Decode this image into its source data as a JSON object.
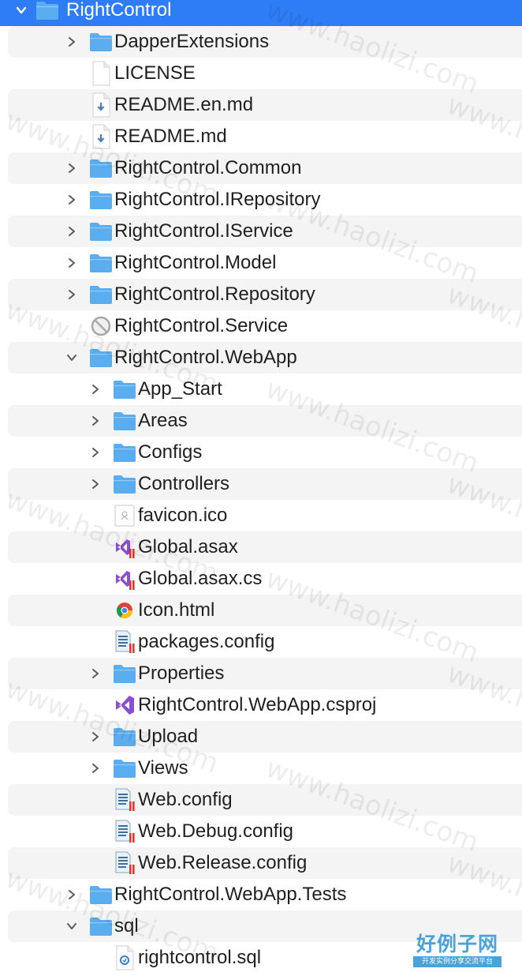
{
  "tree": {
    "items": [
      {
        "label": "RightControl",
        "depth": 0,
        "type": "folder",
        "chevron": "down",
        "selected": true
      },
      {
        "label": "DapperExtensions",
        "depth": 1,
        "type": "folder",
        "chevron": "right"
      },
      {
        "label": "LICENSE",
        "depth": 1,
        "type": "blank-file"
      },
      {
        "label": "README.en.md",
        "depth": 1,
        "type": "markdown-file"
      },
      {
        "label": "README.md",
        "depth": 1,
        "type": "markdown-file"
      },
      {
        "label": "RightControl.Common",
        "depth": 1,
        "type": "folder",
        "chevron": "right"
      },
      {
        "label": "RightControl.IRepository",
        "depth": 1,
        "type": "folder",
        "chevron": "right"
      },
      {
        "label": "RightControl.IService",
        "depth": 1,
        "type": "folder",
        "chevron": "right"
      },
      {
        "label": "RightControl.Model",
        "depth": 1,
        "type": "folder",
        "chevron": "right"
      },
      {
        "label": "RightControl.Repository",
        "depth": 1,
        "type": "folder",
        "chevron": "right"
      },
      {
        "label": "RightControl.Service",
        "depth": 1,
        "type": "unavailable"
      },
      {
        "label": "RightControl.WebApp",
        "depth": 1,
        "type": "folder",
        "chevron": "down"
      },
      {
        "label": "App_Start",
        "depth": 2,
        "type": "folder",
        "chevron": "right"
      },
      {
        "label": "Areas",
        "depth": 2,
        "type": "folder",
        "chevron": "right"
      },
      {
        "label": "Configs",
        "depth": 2,
        "type": "folder",
        "chevron": "right"
      },
      {
        "label": "Controllers",
        "depth": 2,
        "type": "folder",
        "chevron": "right"
      },
      {
        "label": "favicon.ico",
        "depth": 2,
        "type": "image-file"
      },
      {
        "label": "Global.asax",
        "depth": 2,
        "type": "vs-file"
      },
      {
        "label": "Global.asax.cs",
        "depth": 2,
        "type": "vs-file"
      },
      {
        "label": "Icon.html",
        "depth": 2,
        "type": "chrome-file"
      },
      {
        "label": "packages.config",
        "depth": 2,
        "type": "config-file"
      },
      {
        "label": "Properties",
        "depth": 2,
        "type": "folder",
        "chevron": "right"
      },
      {
        "label": "RightControl.WebApp.csproj",
        "depth": 2,
        "type": "vs-project"
      },
      {
        "label": "Upload",
        "depth": 2,
        "type": "folder",
        "chevron": "right"
      },
      {
        "label": "Views",
        "depth": 2,
        "type": "folder",
        "chevron": "right"
      },
      {
        "label": "Web.config",
        "depth": 2,
        "type": "config-file"
      },
      {
        "label": "Web.Debug.config",
        "depth": 2,
        "type": "config-file"
      },
      {
        "label": "Web.Release.config",
        "depth": 2,
        "type": "config-file"
      },
      {
        "label": "RightControl.WebApp.Tests",
        "depth": 1,
        "type": "folder",
        "chevron": "right"
      },
      {
        "label": "sql",
        "depth": 1,
        "type": "folder",
        "chevron": "down"
      },
      {
        "label": "rightcontrol.sql",
        "depth": 2,
        "type": "sql-file"
      }
    ]
  },
  "watermark": {
    "text": "www.haolizi.com"
  },
  "brand": {
    "title": "好例子网",
    "subtitle": "开发实例分享交流平台"
  },
  "colors": {
    "selection": "#2f7df6",
    "folder": "#5aaef0",
    "zebra": "#f4f4f4",
    "text": "#1f1f1f"
  }
}
